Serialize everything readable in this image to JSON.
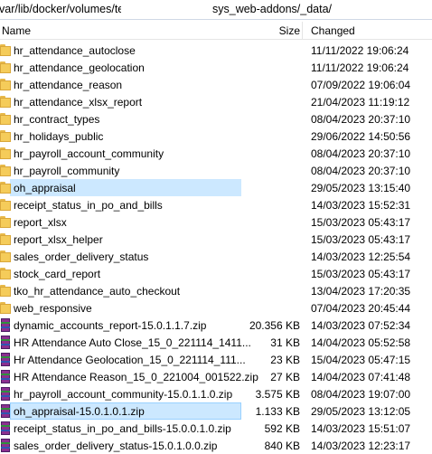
{
  "path": {
    "left": "var/lib/docker/volumes/te",
    "right": "sys_web-addons/_data/"
  },
  "columns": {
    "name": "Name",
    "size": "Size",
    "changed": "Changed"
  },
  "rows": [
    {
      "name": "hr_attendance_autoclose",
      "size": "",
      "changed": "11/11/2022 19:06:24",
      "type": "folder"
    },
    {
      "name": "hr_attendance_geolocation",
      "size": "",
      "changed": "11/11/2022 19:06:24",
      "type": "folder"
    },
    {
      "name": "hr_attendance_reason",
      "size": "",
      "changed": "07/09/2022 19:06:04",
      "type": "folder"
    },
    {
      "name": "hr_attendance_xlsx_report",
      "size": "",
      "changed": "21/04/2023 11:19:12",
      "type": "folder"
    },
    {
      "name": "hr_contract_types",
      "size": "",
      "changed": "08/04/2023 20:37:10",
      "type": "folder"
    },
    {
      "name": "hr_holidays_public",
      "size": "",
      "changed": "29/06/2022 14:50:56",
      "type": "folder"
    },
    {
      "name": "hr_payroll_account_community",
      "size": "",
      "changed": "08/04/2023 20:37:10",
      "type": "folder"
    },
    {
      "name": "hr_payroll_community",
      "size": "",
      "changed": "08/04/2023 20:37:10",
      "type": "folder"
    },
    {
      "name": "oh_appraisal",
      "size": "",
      "changed": "29/05/2023 13:15:40",
      "type": "folder",
      "state": "selected"
    },
    {
      "name": "receipt_status_in_po_and_bills",
      "size": "",
      "changed": "14/03/2023 15:52:31",
      "type": "folder"
    },
    {
      "name": "report_xlsx",
      "size": "",
      "changed": "15/03/2023 05:43:17",
      "type": "folder"
    },
    {
      "name": "report_xlsx_helper",
      "size": "",
      "changed": "15/03/2023 05:43:17",
      "type": "folder"
    },
    {
      "name": "sales_order_delivery_status",
      "size": "",
      "changed": "14/03/2023 12:25:54",
      "type": "folder"
    },
    {
      "name": "stock_card_report",
      "size": "",
      "changed": "15/03/2023 05:43:17",
      "type": "folder"
    },
    {
      "name": "tko_hr_attendance_auto_checkout",
      "size": "",
      "changed": "13/04/2023 17:20:35",
      "type": "folder"
    },
    {
      "name": "web_responsive",
      "size": "",
      "changed": "07/04/2023 20:45:44",
      "type": "folder"
    },
    {
      "name": "dynamic_accounts_report-15.0.1.1.7.zip",
      "size": "20.356 KB",
      "changed": "14/03/2023 07:52:34",
      "type": "archive"
    },
    {
      "name": "HR Attendance Auto Close_15_0_221114_1411...",
      "size": "31 KB",
      "changed": "14/04/2023 05:52:58",
      "type": "archive"
    },
    {
      "name": "Hr Attendance Geolocation_15_0_221114_111...",
      "size": "23 KB",
      "changed": "15/04/2023 05:47:15",
      "type": "archive"
    },
    {
      "name": "HR Attendance Reason_15_0_221004_001522.zip",
      "size": "27 KB",
      "changed": "14/04/2023 07:41:48",
      "type": "archive"
    },
    {
      "name": "hr_payroll_account_community-15.0.1.1.0.zip",
      "size": "3.575 KB",
      "changed": "08/04/2023 19:07:00",
      "type": "archive"
    },
    {
      "name": "oh_appraisal-15.0.1.0.1.zip",
      "size": "1.133 KB",
      "changed": "29/05/2023 13:12:05",
      "type": "archive",
      "state": "focused"
    },
    {
      "name": "receipt_status_in_po_and_bills-15.0.0.1.0.zip",
      "size": "592 KB",
      "changed": "14/03/2023 15:51:07",
      "type": "archive"
    },
    {
      "name": "sales_order_delivery_status-15.0.1.0.0.zip",
      "size": "840 KB",
      "changed": "14/03/2023 12:23:17",
      "type": "archive"
    }
  ]
}
